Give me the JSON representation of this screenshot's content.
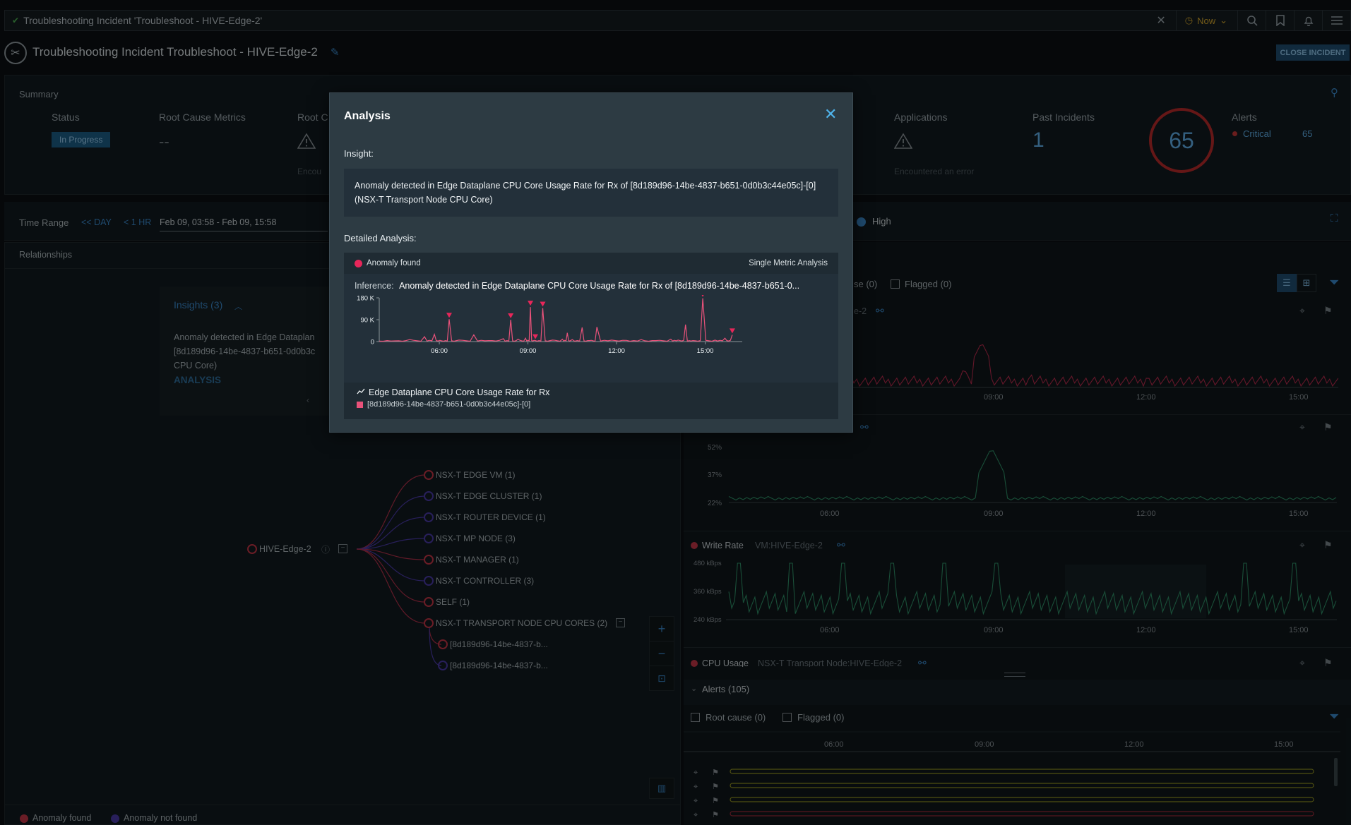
{
  "topbar": {
    "query": "Troubleshooting Incident 'Troubleshoot - HIVE-Edge-2'",
    "time_label": "Now"
  },
  "header": {
    "title": "Troubleshooting Incident Troubleshoot - HIVE-Edge-2",
    "close_label": "CLOSE INCIDENT"
  },
  "summary": {
    "section_label": "Summary",
    "status_label": "Status",
    "status_value": "In Progress",
    "root_cause_metrics_label": "Root Cause Metrics",
    "root_cause_metrics_value": "--",
    "root_c_label": "Root C",
    "root_c_status": "Encou",
    "applications_label": "Applications",
    "applications_status": "Encountered an error",
    "past_incidents_label": "Past Incidents",
    "past_incidents_value": "1",
    "score": "65",
    "alerts_label": "Alerts",
    "alerts_critical_label": "Critical",
    "alerts_critical_count": "65"
  },
  "timerange": {
    "label": "Time Range",
    "day_btn": "<< DAY",
    "hr_btn": "< 1 HR",
    "range": "Feb 09, 03:58 - Feb 09, 15:58",
    "high": "High"
  },
  "relationships": {
    "label": "Relationships"
  },
  "insights_panel": {
    "title": "Insights (3)",
    "text1": "Anomaly detected in Edge Dataplan",
    "text2": "[8d189d96-14be-4837-b651-0d0b3c",
    "text3": "CPU Core)",
    "link": "ANALYSIS"
  },
  "tree": {
    "root": "HIVE-Edge-2",
    "children": [
      {
        "label": "NSX-T EDGE VM (1)"
      },
      {
        "label": "NSX-T EDGE CLUSTER (1)"
      },
      {
        "label": "NSX-T ROUTER DEVICE (1)"
      },
      {
        "label": "NSX-T MP NODE (3)"
      },
      {
        "label": "NSX-T MANAGER (1)"
      },
      {
        "label": "NSX-T CONTROLLER (3)"
      },
      {
        "label": "SELF (1)"
      },
      {
        "label": "NSX-T TRANSPORT NODE CPU CORES (2)"
      }
    ],
    "grandchildren": [
      {
        "label": "[8d189d96-14be-4837-b..."
      },
      {
        "label": "[8d189d96-14be-4837-b..."
      }
    ]
  },
  "legend": {
    "found": "Anomaly found",
    "not_found": "Anomaly not found"
  },
  "right": {
    "filter_root": "se (0)",
    "filter_flagged": "Flagged (0)",
    "card1_sub": "e-2",
    "card3_name": "Write Rate",
    "card3_sub": "VM:HIVE-Edge-2",
    "card4_name": "CPU Usage",
    "card4_sub": "NSX-T Transport Node:HIVE-Edge-2",
    "y2": [
      "52%",
      "37%",
      "22%"
    ],
    "y3": [
      "480 kBps",
      "360 kBps",
      "240 kBps"
    ],
    "xticks": [
      "06:00",
      "09:00",
      "12:00",
      "15:00"
    ],
    "alerts_title": "Alerts (105)",
    "alerts_root": "Root cause (0)",
    "alerts_flagged": "Flagged (0)"
  },
  "modal": {
    "title": "Analysis",
    "insight_label": "Insight:",
    "insight_text": "Anomaly detected in Edge Dataplane CPU Core Usage Rate for Rx of [8d189d96-14be-4837-b651-0d0b3c44e05c]-[0] (NSX-T Transport Node CPU Core)",
    "detailed_label": "Detailed Analysis:",
    "anomaly_found": "Anomaly found",
    "analysis_type": "Single Metric Analysis",
    "inference_label": "Inference:",
    "inference_text": "Anomaly detected in Edge Dataplane CPU Core Usage Rate for Rx of [8d189d96-14be-4837-b651-0...",
    "metric_name": "Edge Dataplane CPU Core Usage Rate for Rx",
    "series_name": "[8d189d96-14be-4837-b651-0d0b3c44e05c]-[0]"
  },
  "chart_data": {
    "type": "line",
    "ylabels": [
      "180 K",
      "90 K",
      "0"
    ],
    "ylim": [
      0,
      180000
    ],
    "xticks": [
      "06:00",
      "09:00",
      "12:00",
      "15:00"
    ],
    "xlim": [
      "03:58",
      "15:58"
    ],
    "series": [
      {
        "name": "[8d189d96-14be-4837-b651-0d0b3c44e05c]-[0]",
        "color": "#e8527a",
        "x": [
          "03:58",
          "04:30",
          "05:00",
          "05:30",
          "05:50",
          "06:05",
          "06:20",
          "06:40",
          "07:10",
          "07:40",
          "08:10",
          "08:25",
          "08:40",
          "08:55",
          "09:05",
          "09:15",
          "09:30",
          "09:50",
          "10:10",
          "10:20",
          "10:30",
          "10:50",
          "11:05",
          "11:20",
          "11:50",
          "12:20",
          "12:50",
          "13:20",
          "13:50",
          "14:05",
          "14:20",
          "14:35",
          "14:55",
          "15:20",
          "15:40",
          "15:55"
        ],
        "y": [
          2000,
          3000,
          8000,
          20000,
          30000,
          3000,
          92000,
          6000,
          28000,
          4000,
          12000,
          90000,
          10000,
          14000,
          142000,
          4000,
          138000,
          6000,
          10000,
          36000,
          8000,
          58000,
          4000,
          60000,
          6000,
          5000,
          8000,
          4000,
          10000,
          6000,
          70000,
          4000,
          178000,
          6000,
          14000,
          28000
        ]
      }
    ],
    "anomaly_x": [
      "06:20",
      "08:25",
      "09:05",
      "09:15",
      "09:30",
      "14:55",
      "15:55"
    ],
    "anomaly_color": "#e8265a"
  }
}
